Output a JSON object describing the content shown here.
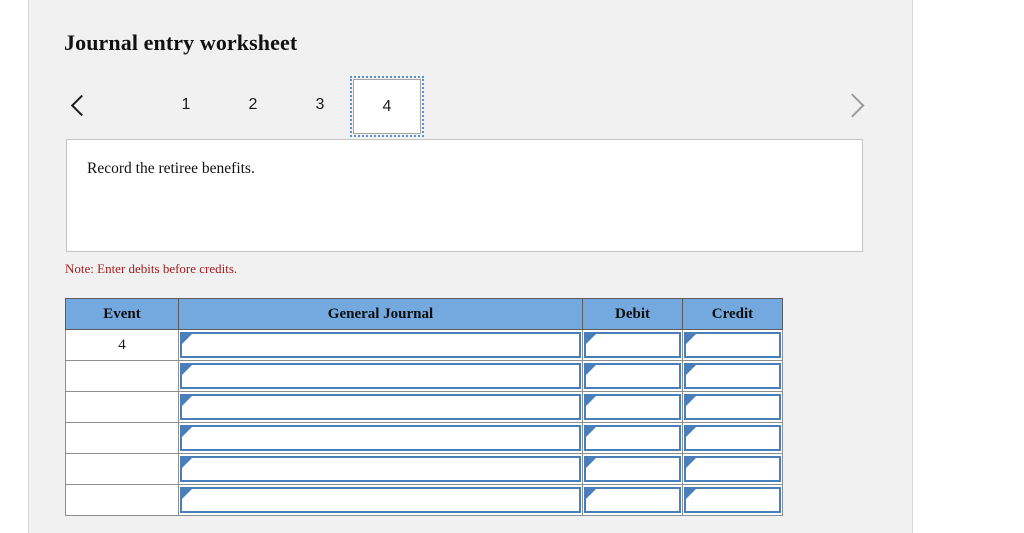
{
  "panel": {
    "title": "Journal entry worksheet"
  },
  "tabs": {
    "prev_icon": "chevron-left-icon",
    "next_icon": "chevron-right-icon",
    "items": [
      {
        "label": "1",
        "selected": false
      },
      {
        "label": "2",
        "selected": false
      },
      {
        "label": "3",
        "selected": false
      },
      {
        "label": "4",
        "selected": true
      }
    ]
  },
  "instruction": {
    "text": "Record the retiree benefits."
  },
  "note": {
    "text": "Note: Enter debits before credits."
  },
  "table": {
    "headers": {
      "event": "Event",
      "general_journal": "General Journal",
      "debit": "Debit",
      "credit": "Credit"
    },
    "rows": [
      {
        "event": "4",
        "general_journal": "",
        "debit": "",
        "credit": ""
      },
      {
        "event": "",
        "general_journal": "",
        "debit": "",
        "credit": ""
      },
      {
        "event": "",
        "general_journal": "",
        "debit": "",
        "credit": ""
      },
      {
        "event": "",
        "general_journal": "",
        "debit": "",
        "credit": ""
      },
      {
        "event": "",
        "general_journal": "",
        "debit": "",
        "credit": ""
      },
      {
        "event": "",
        "general_journal": "",
        "debit": "",
        "credit": ""
      }
    ]
  },
  "colors": {
    "header_blue": "#74A9E0",
    "input_border_blue": "#4A7EBB",
    "note_red": "#a02020",
    "panel_bg": "#f1f1f1"
  }
}
